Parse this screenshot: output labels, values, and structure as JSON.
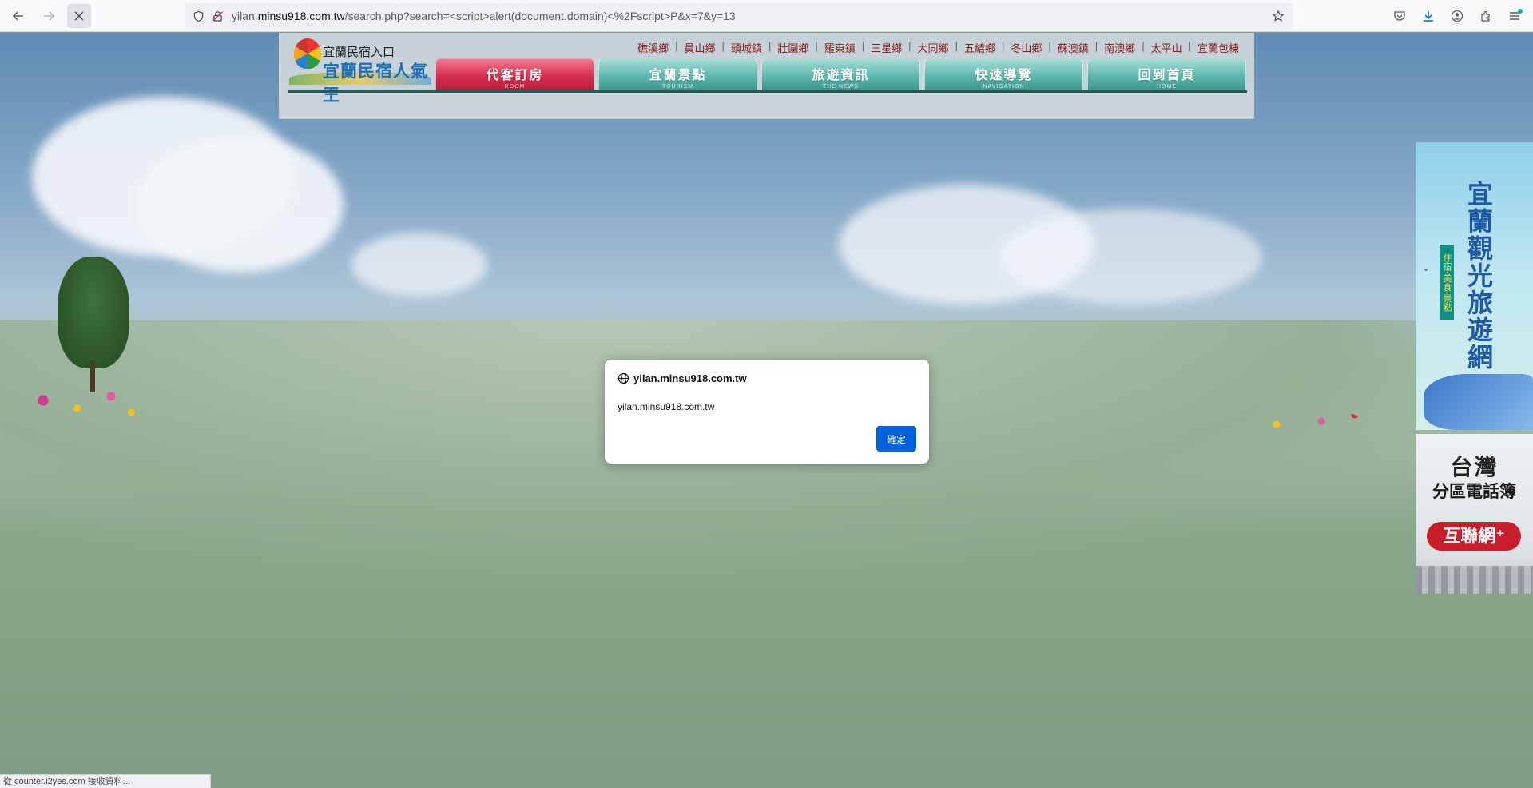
{
  "browser": {
    "url_domain_prefix": "yilan.",
    "url_domain": "minsu918.com.tw",
    "url_path": "/search.php?search=<script>alert(document.domain)<%2Fscript>P&x=7&y=13",
    "status_text": "從 counter.i2yes.com 接收資料..."
  },
  "site": {
    "logo_line1": "宜蘭民宿入口",
    "logo_line2": "宜蘭民宿人氣王",
    "town_links": [
      "礁溪鄉",
      "員山鄉",
      "頭城鎮",
      "壯圍鄉",
      "羅東鎮",
      "三星鄉",
      "大同鄉",
      "五結鄉",
      "冬山鄉",
      "蘇澳鎮",
      "南澳鄉",
      "太平山",
      "宜蘭包棟"
    ],
    "menu": [
      {
        "label": "代客訂房",
        "sub": "ROOM",
        "color": "red"
      },
      {
        "label": "宜蘭景點",
        "sub": "TOURISM",
        "color": "teal"
      },
      {
        "label": "旅遊資訊",
        "sub": "THE NEWS",
        "color": "teal"
      },
      {
        "label": "快速導覽",
        "sub": "NAVIGATION",
        "color": "teal"
      },
      {
        "label": "回到首頁",
        "sub": "HOME",
        "color": "teal"
      }
    ]
  },
  "side_ads": {
    "ad1_title": "宜蘭觀光旅遊網",
    "ad1_sub": "住宿‧美食‧景點",
    "ad2_title": "台灣",
    "ad2_sub": "分區電話簿",
    "ad2_pill": "互聯網⁺"
  },
  "dialog": {
    "origin": "yilan.minsu918.com.tw",
    "message": "yilan.minsu918.com.tw",
    "ok_label": "確定"
  }
}
